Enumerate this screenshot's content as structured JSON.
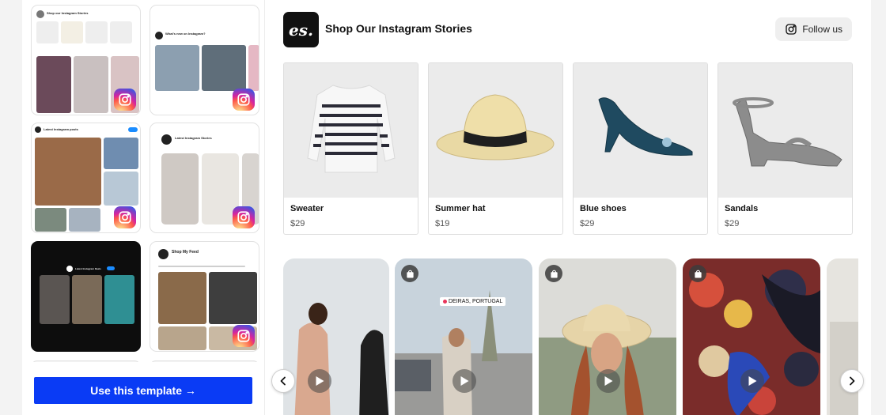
{
  "gallery": {
    "thumbnails": [
      {
        "title": "Shop our Instagram Stories"
      },
      {
        "title": "What's new on Instagram?"
      },
      {
        "title": "Latest Instagram posts"
      },
      {
        "title": "Latest Instagram Stories"
      },
      {
        "title": "Latest Instagram Reels"
      },
      {
        "title": "Shop My Feed"
      }
    ],
    "cta_label": "Use this template →"
  },
  "widget": {
    "logo_text": "es.",
    "title": "Shop Our Instagram Stories",
    "follow_label": "Follow us",
    "products": [
      {
        "name": "Sweater",
        "price": "$29"
      },
      {
        "name": "Summer hat",
        "price": "$19"
      },
      {
        "name": "Blue shoes",
        "price": "$29"
      },
      {
        "name": "Sandals",
        "price": "$29"
      }
    ],
    "stories": [
      {
        "location": ""
      },
      {
        "location": "DEIRAS, PORTUGAL"
      },
      {
        "location": ""
      },
      {
        "location": ""
      }
    ]
  },
  "colors": {
    "cta": "#0a3bf5",
    "page_bg": "#f3f3f3",
    "instagram_gradient": [
      "#fdf497",
      "#fd5949",
      "#d6249f",
      "#285AEB"
    ]
  },
  "icons": {
    "follow": "instagram-icon",
    "story_badge": "shopping-bag-icon",
    "story_play": "play-icon",
    "carousel_prev": "chevron-left-icon",
    "carousel_next": "chevron-right-icon"
  }
}
